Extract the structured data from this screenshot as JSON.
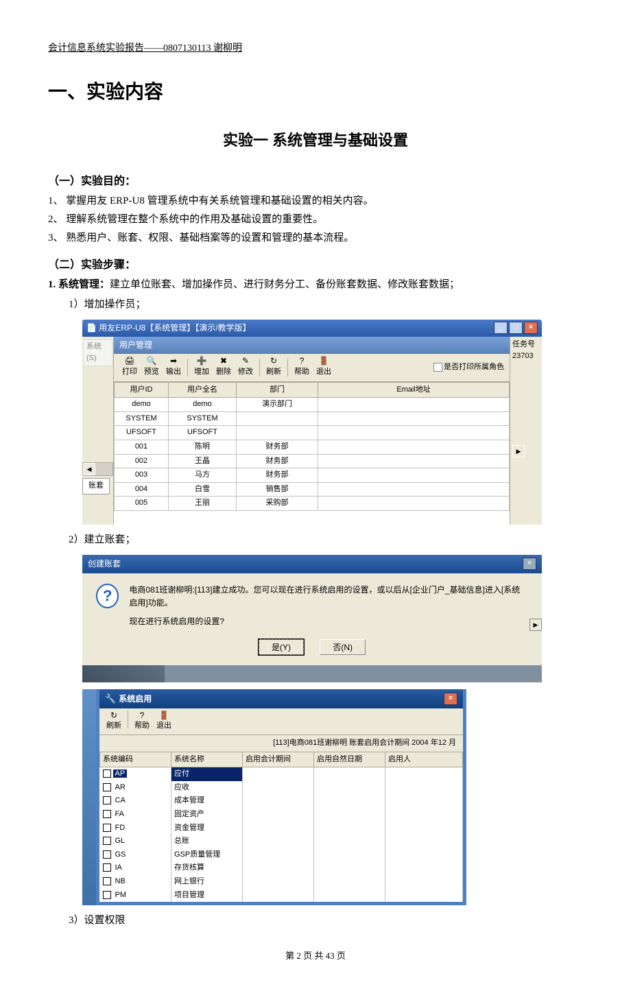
{
  "header": "会计信息系统实验报告——0807130113 谢柳明",
  "h1": "一、实验内容",
  "h2": "实验一  系统管理与基础设置",
  "sec1_title": "（一）实验目的：",
  "goal1": "1、 掌握用友 ERP-U8 管理系统中有关系统管理和基础设置的相关内容。",
  "goal2": "2、 理解系统管理在整个系统中的作用及基础设置的重要性。",
  "goal3": "3、 熟悉用户、账套、权限、基础档案等的设置和管理的基本流程。",
  "sec2_title": "（二）实验步骤：",
  "step1_title": "1. 系统管理：",
  "step1_body": "建立单位账套、增加操作员、进行财务分工、备份账套数据、修改账套数据；",
  "step1_1": "1）增加操作员；",
  "step1_2": "2）建立账套；",
  "step1_3": "3）设置权限",
  "footer": "第 2 页 共 43 页",
  "win1": {
    "title": "用友ERP-U8【系统管理】【演示/教学版】",
    "menu": "系统(S)",
    "inner_title": "用户管理",
    "toolbar": {
      "print": "打印",
      "preview": "预览",
      "output": "输出",
      "add": "增加",
      "del": "删除",
      "edit": "修改",
      "refresh": "刷新",
      "help": "帮助",
      "exit": "退出"
    },
    "chk_label": "是否打印所属角色",
    "right_col1": "任务号",
    "right_col2": "23703",
    "tab": "账套",
    "headers": {
      "id": "用户ID",
      "name": "用户全名",
      "dept": "部门",
      "email": "Email地址"
    },
    "rows": [
      {
        "id": "demo",
        "name": "demo",
        "dept": "演示部门",
        "email": ""
      },
      {
        "id": "SYSTEM",
        "name": "SYSTEM",
        "dept": "",
        "email": ""
      },
      {
        "id": "UFSOFT",
        "name": "UFSOFT",
        "dept": "",
        "email": ""
      },
      {
        "id": "001",
        "name": "陈明",
        "dept": "财务部",
        "email": ""
      },
      {
        "id": "002",
        "name": "王晶",
        "dept": "财务部",
        "email": ""
      },
      {
        "id": "003",
        "name": "马方",
        "dept": "财务部",
        "email": ""
      },
      {
        "id": "004",
        "name": "白雪",
        "dept": "销售部",
        "email": ""
      },
      {
        "id": "005",
        "name": "王丽",
        "dept": "采购部",
        "email": ""
      }
    ]
  },
  "dlg": {
    "title": "创建账套",
    "line1": "电商081班谢柳明:[113]建立成功。您可以现在进行系统启用的设置，或以后从[企业门户_基础信息]进入[系统启用]功能。",
    "line2": "现在进行系统启用的设置?",
    "yes": "是(Y)",
    "no": "否(N)"
  },
  "win3": {
    "title": "系统启用",
    "toolbar": {
      "refresh": "刷新",
      "help": "帮助",
      "exit": "退出"
    },
    "info": "[113]电商081班谢柳明  账套启用会计期间 2004 年12 月",
    "headers": {
      "code": "系统编码",
      "name": "系统名称",
      "period": "启用会计期间",
      "date": "启用自然日期",
      "user": "启用人"
    },
    "rows": [
      {
        "code": "AP",
        "name": "应付",
        "hl": true
      },
      {
        "code": "AR",
        "name": "应收"
      },
      {
        "code": "CA",
        "name": "成本管理"
      },
      {
        "code": "FA",
        "name": "固定资产"
      },
      {
        "code": "FD",
        "name": "资金管理"
      },
      {
        "code": "GL",
        "name": "总账"
      },
      {
        "code": "GS",
        "name": "GSP质量管理"
      },
      {
        "code": "IA",
        "name": "存货核算"
      },
      {
        "code": "NB",
        "name": "网上银行"
      },
      {
        "code": "PM",
        "name": "项目管理"
      }
    ]
  }
}
